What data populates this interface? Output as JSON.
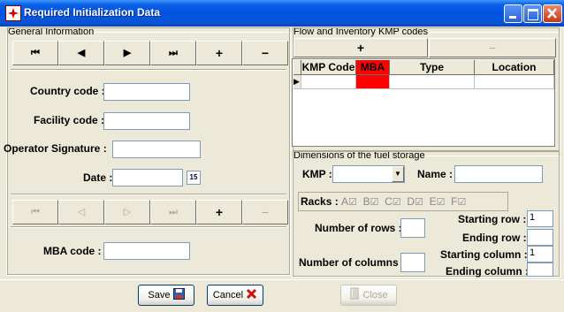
{
  "window": {
    "title": "Required Initialization Data"
  },
  "general": {
    "legend": "General Information",
    "nav": [
      "⏮",
      "◀",
      "▶",
      "⏭",
      "+",
      "−"
    ],
    "country_label": "Country code :",
    "country_value": "",
    "facility_label": "Facility code :",
    "facility_value": "",
    "operator_label": "Operator Signature :",
    "operator_value": "",
    "date_label": "Date :",
    "date_value": "",
    "date_btn": "15",
    "mba_nav": [
      "⏮",
      "◁",
      "▷",
      "⏭",
      "+",
      "−"
    ],
    "mba_label": "MBA code :",
    "mba_value": ""
  },
  "flow": {
    "legend": "Flow and Inventory KMP codes",
    "add": "+",
    "remove": "−",
    "columns": [
      "KMP Code",
      "MBA",
      "Type",
      "Location"
    ],
    "row_marker": "▶"
  },
  "dims": {
    "legend": "Dimensions of the fuel storage",
    "kmp_label": "KMP :",
    "kmp_value": "",
    "name_label": "Name :",
    "name_value": "",
    "racks_label": "Racks :",
    "racks": [
      {
        "letter": "A",
        "mark": "☑"
      },
      {
        "letter": "B",
        "mark": "☑"
      },
      {
        "letter": "C",
        "mark": "☑"
      },
      {
        "letter": "D",
        "mark": "☑"
      },
      {
        "letter": "E",
        "mark": "☑"
      },
      {
        "letter": "F",
        "mark": "☑"
      }
    ],
    "rows_label": "Number of rows :",
    "rows_value": "",
    "cols_label": "Number of columns :",
    "cols_value": "",
    "start_row_label": "Starting row :",
    "start_row_value": "1",
    "end_row_label": "Ending row :",
    "end_row_value": "",
    "start_col_label": "Starting column :",
    "start_col_value": "1",
    "end_col_label": "Ending column :",
    "end_col_value": ""
  },
  "footer": {
    "save": "Save",
    "cancel": "Cancel",
    "close": "Close"
  },
  "colors": {
    "mba_header": "#FF0000",
    "title_bar": "#0054E3"
  }
}
